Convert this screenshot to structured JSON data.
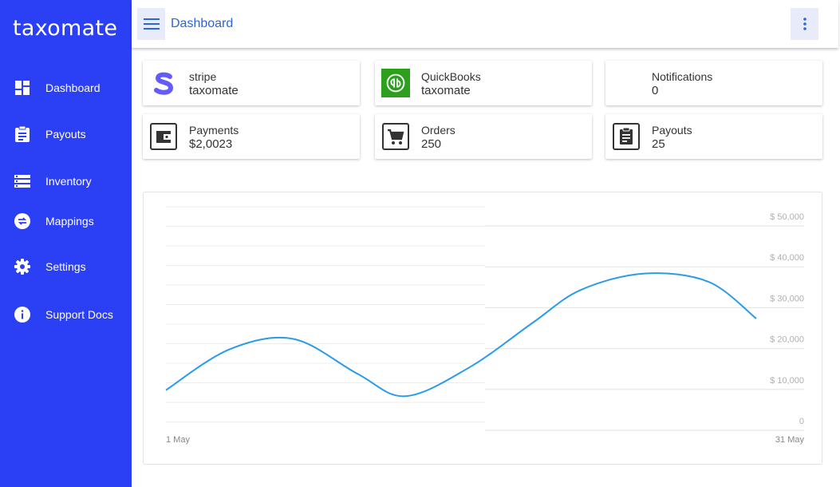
{
  "app": {
    "logo": "taxomate"
  },
  "sidebar": {
    "items": [
      {
        "label": "Dashboard",
        "icon": "dashboard-icon"
      },
      {
        "label": "Payouts",
        "icon": "clipboard-icon"
      },
      {
        "label": "Inventory",
        "icon": "list-icon"
      },
      {
        "label": "Mappings",
        "icon": "swap-icon"
      },
      {
        "label": "Settings",
        "icon": "gear-icon"
      },
      {
        "label": "Support Docs",
        "icon": "info-icon"
      }
    ]
  },
  "header": {
    "title": "Dashboard"
  },
  "cards": [
    {
      "title": "stripe",
      "value": "taxomate",
      "icon": "stripe-logo-icon"
    },
    {
      "title": "QuickBooks",
      "value": "taxomate",
      "icon": "quickbooks-logo-icon"
    },
    {
      "title": "Notifications",
      "value": "0",
      "icon": ""
    },
    {
      "title": "Payments",
      "value": "$2,0023",
      "icon": "wallet-icon"
    },
    {
      "title": "Orders",
      "value": "250",
      "icon": "cart-icon"
    },
    {
      "title": "Payouts",
      "value": "25",
      "icon": "clipboard-icon"
    }
  ],
  "colors": {
    "sidebar": "#2b3ff5",
    "accent": "#2a66d8",
    "line": "#2a9be8",
    "stripe": "#635bff",
    "quickbooks": "#2ca01c"
  },
  "chart_data": {
    "type": "line",
    "x_ticks": [
      "1 May",
      "31 May"
    ],
    "y_ticks": [
      "0",
      "$ 10,000",
      "$ 20,000",
      "$ 30,000",
      "$ 40,000",
      "$ 50,000"
    ],
    "ylim": [
      0,
      50000
    ],
    "grid": true,
    "series": [
      {
        "points": [
          [
            1,
            7500
          ],
          [
            5,
            17500
          ],
          [
            9,
            20000
          ],
          [
            13,
            11500
          ],
          [
            16,
            6000
          ],
          [
            20,
            13000
          ],
          [
            24,
            24000
          ],
          [
            27,
            32000
          ],
          [
            31,
            36000
          ],
          [
            35,
            34000
          ],
          [
            38,
            25000
          ]
        ]
      }
    ]
  }
}
